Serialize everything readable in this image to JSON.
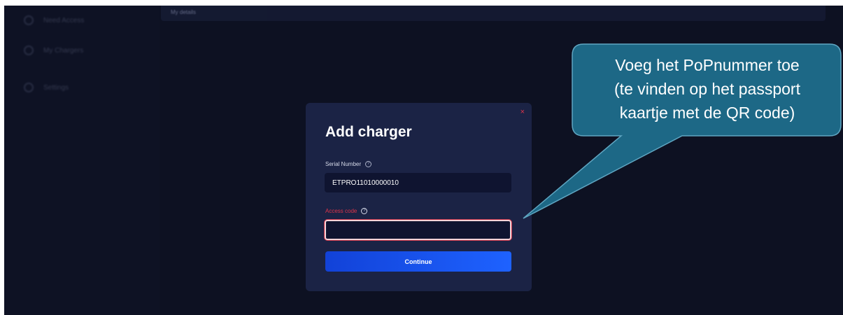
{
  "sidebar": {
    "items": [
      {
        "label": "Need Access",
        "icon": "circle-icon"
      },
      {
        "label": "My Chargers",
        "icon": "circle-icon"
      },
      {
        "label": "Settings",
        "icon": "gear-icon"
      }
    ]
  },
  "topbar": {
    "label": "My details"
  },
  "modal": {
    "title": "Add charger",
    "close_icon": "×",
    "serial": {
      "label": "Serial Number",
      "value": "ETPRO11010000010"
    },
    "access_code": {
      "label": "Access code",
      "value": ""
    },
    "continue_label": "Continue"
  },
  "callout": {
    "text": "Voeg het PoPnummer toe\n(te vinden op het passport\nkaartje met de QR code)",
    "color": "#1d6886"
  },
  "colors": {
    "background": "#0d1122",
    "modal": "#1b2345",
    "accent": "#1e62ff",
    "error": "#e0344a"
  }
}
